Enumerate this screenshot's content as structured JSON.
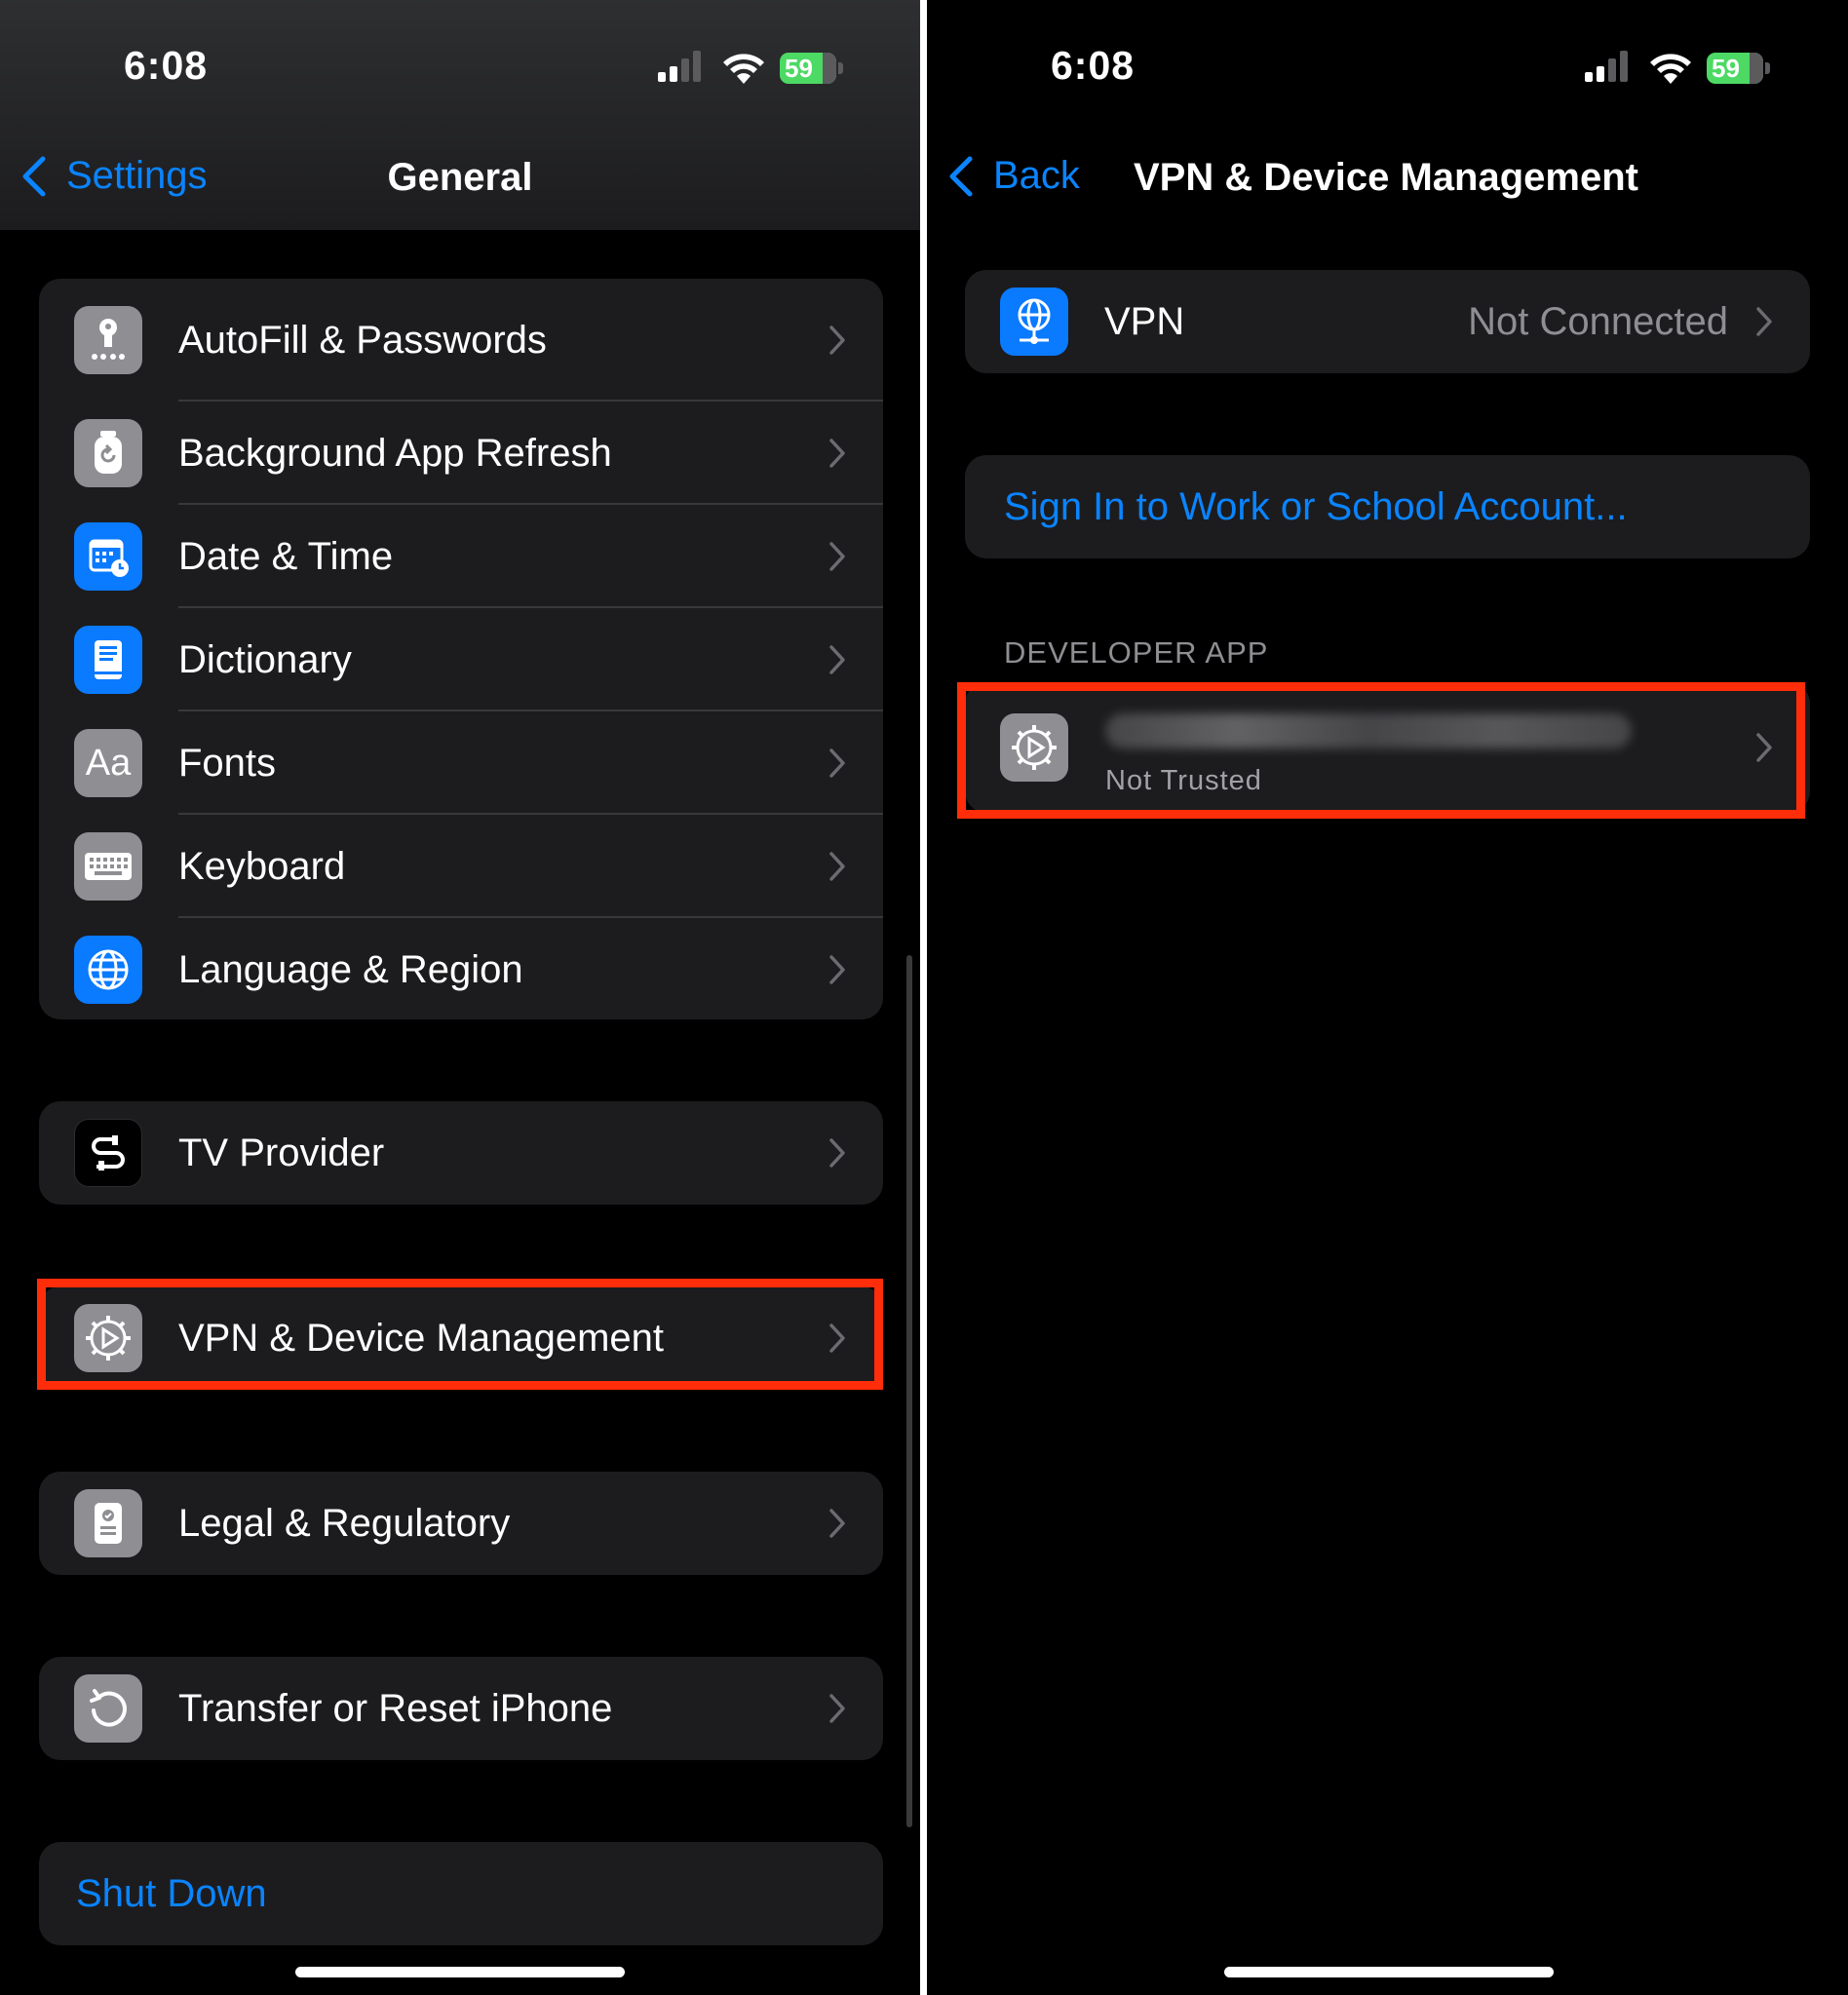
{
  "left": {
    "status": {
      "time": "6:08",
      "battery": "59"
    },
    "nav": {
      "back_label": "Settings",
      "title": "General"
    },
    "groups": {
      "main": [
        {
          "label": "AutoFill & Passwords",
          "icon": "key-icon"
        },
        {
          "label": "Background App Refresh",
          "icon": "refresh-icon"
        },
        {
          "label": "Date & Time",
          "icon": "calendar-clock-icon"
        },
        {
          "label": "Dictionary",
          "icon": "book-icon"
        },
        {
          "label": "Fonts",
          "icon": "fonts-icon",
          "glyph": "Aa"
        },
        {
          "label": "Keyboard",
          "icon": "keyboard-icon"
        },
        {
          "label": "Language & Region",
          "icon": "globe-icon"
        }
      ],
      "tv": {
        "label": "TV Provider",
        "icon": "tv-provider-icon"
      },
      "vpn": {
        "label": "VPN & Device Management",
        "icon": "gear-icon"
      },
      "legal": {
        "label": "Legal & Regulatory",
        "icon": "document-icon"
      },
      "transfer": {
        "label": "Transfer or Reset iPhone",
        "icon": "reset-icon"
      },
      "shutdown": {
        "label": "Shut Down"
      }
    }
  },
  "right": {
    "status": {
      "time": "6:08",
      "battery": "59"
    },
    "nav": {
      "back_label": "Back",
      "title": "VPN & Device Management"
    },
    "vpn": {
      "label": "VPN",
      "value": "Not Connected",
      "icon": "vpn-globe-icon"
    },
    "sign_in": {
      "label": "Sign In to Work or School Account..."
    },
    "developer_section": {
      "header": "DEVELOPER APP",
      "app": {
        "status": "Not Trusted",
        "icon": "gear-icon"
      }
    }
  },
  "colors": {
    "accent": "#0a84ff",
    "highlight": "#ff2d0a",
    "battery": "#4cd964"
  }
}
